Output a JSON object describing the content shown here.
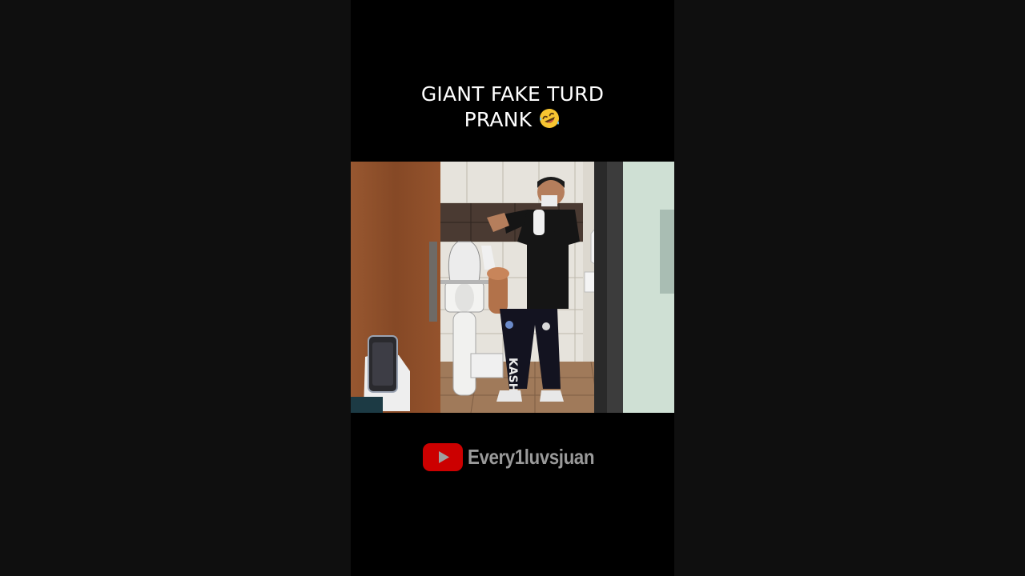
{
  "video": {
    "title_line1": "GIANT FAKE TURD",
    "title_line2": "PRANK",
    "title_emoji": "rolling-on-floor-laughing-emoji"
  },
  "watermark": {
    "icon": "youtube-logo-icon",
    "channel_name": "Every1luvsjuan"
  },
  "scene": {
    "description_icons": [
      "phone-icon"
    ],
    "pants_text": "KASH"
  },
  "colors": {
    "background": "#0f0f0f",
    "video_background": "#000000",
    "title_text": "#ffffff",
    "watermark_text": "#9a9a9a",
    "youtube_red": "#cc0000"
  }
}
